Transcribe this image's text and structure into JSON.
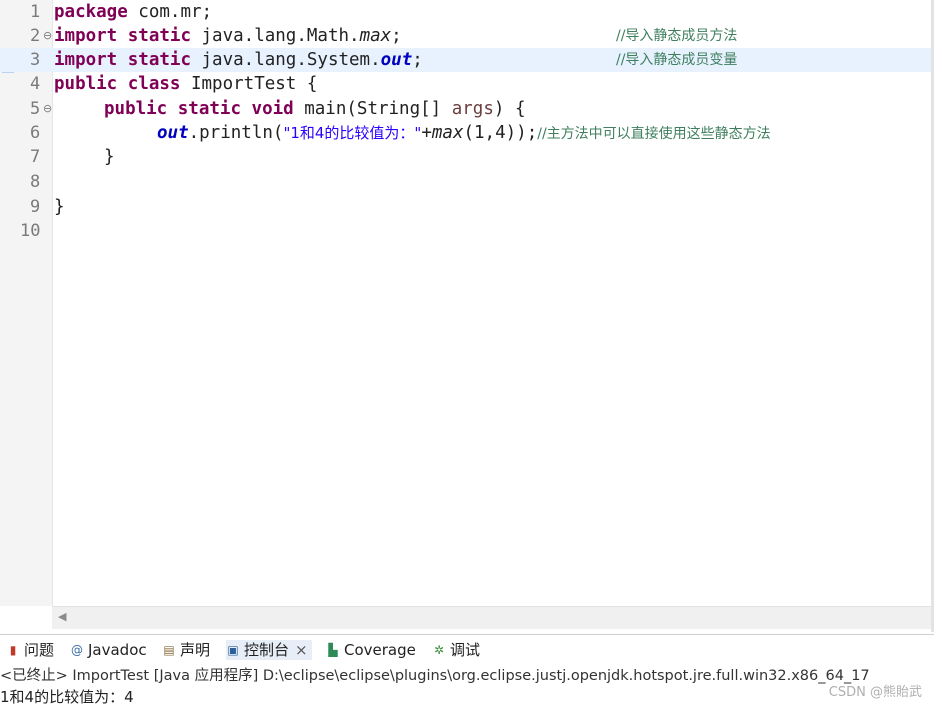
{
  "editor": {
    "lines": [
      {
        "num": "1"
      },
      {
        "num": "2",
        "fold": "⊖"
      },
      {
        "num": "3"
      },
      {
        "num": "4"
      },
      {
        "num": "5",
        "fold": "⊖"
      },
      {
        "num": "6"
      },
      {
        "num": "7"
      },
      {
        "num": "8"
      },
      {
        "num": "9"
      },
      {
        "num": "10"
      }
    ],
    "code": {
      "l1_kw": "package",
      "l1_rest": " com.mr;",
      "l2_kw1": "import",
      "l2_kw2": "static",
      "l2_pkg": " java.lang.Math.",
      "l2_member": "max",
      "l2_end": ";",
      "l2_comment": "//导入静态成员方法",
      "l3_kw1": "import",
      "l3_kw2": "static",
      "l3_pkg": " java.lang.System.",
      "l3_member": "out",
      "l3_end": ";",
      "l3_comment": "//导入静态成员变量",
      "l4_kw1": "public",
      "l4_kw2": "class",
      "l4_rest": " ImportTest {",
      "l5_kw1": "public",
      "l5_kw2": "static",
      "l5_kw3": "void",
      "l5_rest": " main(String[] ",
      "l5_args": "args",
      "l5_end": ") {",
      "l6_field": "out",
      "l6_call": ".println(",
      "l6_str": "\"1和4的比较值为：\"",
      "l6_plus": "+",
      "l6_max": "max",
      "l6_args": "(1,4));",
      "l6_comment": "//主方法中可以直接使用这些静态方法",
      "l7": "}",
      "l9": "}"
    }
  },
  "console": {
    "tabs": [
      {
        "label": "问题",
        "icon": "problems-icon"
      },
      {
        "label": "Javadoc",
        "icon": "javadoc-icon"
      },
      {
        "label": "声明",
        "icon": "declaration-icon"
      },
      {
        "label": "控制台",
        "icon": "console-icon",
        "close": "×"
      },
      {
        "label": "Coverage",
        "icon": "coverage-icon"
      },
      {
        "label": "调试",
        "icon": "debug-icon"
      }
    ],
    "status": "<已终止> ImportTest [Java 应用程序] D:\\eclipse\\eclipse\\plugins\\org.eclipse.justj.openjdk.hotspot.jre.full.win32.x86_64_17",
    "output": "1和4的比较值为：4"
  },
  "watermark": "CSDN @熊貽武"
}
